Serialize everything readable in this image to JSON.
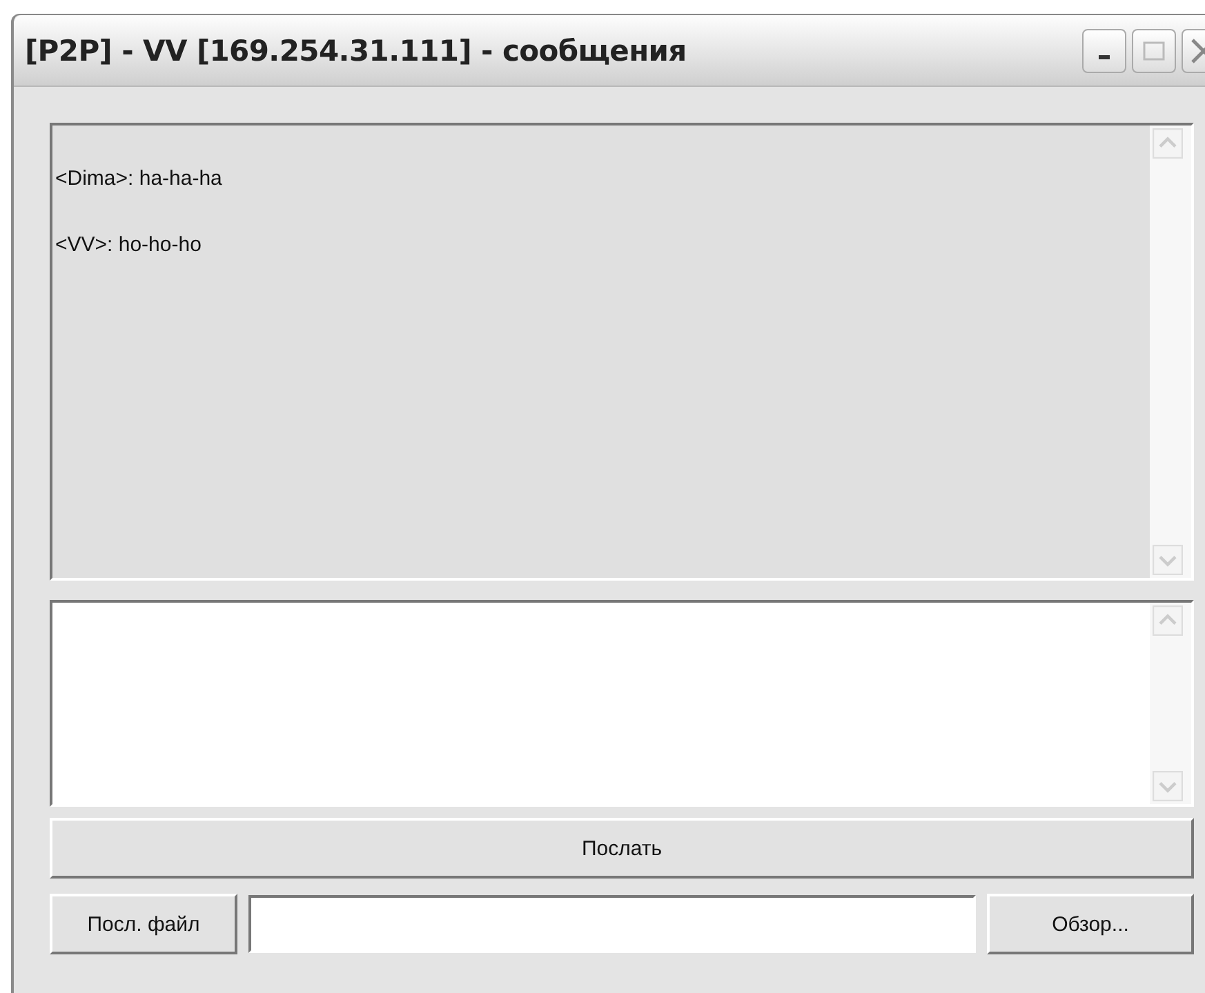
{
  "window": {
    "title": "[P2P] - VV [169.254.31.111] - сообщения"
  },
  "messages": [
    {
      "text": "<Dima>: ha-ha-ha"
    },
    {
      "text": "<VV>: ho-ho-ho"
    }
  ],
  "send_button": "Послать",
  "send_file_button": "Посл. файл",
  "browse_button": "Обзор..."
}
